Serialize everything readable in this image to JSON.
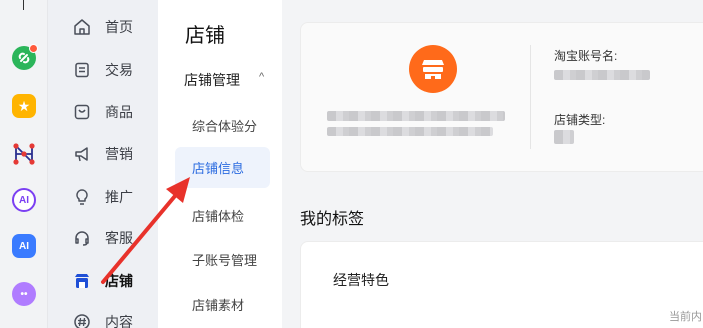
{
  "rail": {
    "apps": [
      {
        "icon": "green-link-app-icon",
        "badge": true
      },
      {
        "icon": "yellow-star-app-icon",
        "glyph": "★"
      },
      {
        "icon": "red-graph-app-icon"
      },
      {
        "icon": "ai-circle-app-icon",
        "glyph": "AI"
      },
      {
        "icon": "ai-square-app-icon",
        "glyph": "AI"
      },
      {
        "icon": "purple-bot-app-icon",
        "glyph": "••"
      }
    ]
  },
  "nav": {
    "items": [
      {
        "label": "首页",
        "icon": "home-icon"
      },
      {
        "label": "交易",
        "icon": "transaction-icon"
      },
      {
        "label": "商品",
        "icon": "product-icon"
      },
      {
        "label": "营销",
        "icon": "megaphone-icon"
      },
      {
        "label": "推广",
        "icon": "lightbulb-icon"
      },
      {
        "label": "客服",
        "icon": "headset-icon"
      },
      {
        "label": "店铺",
        "icon": "store-icon",
        "active": true
      },
      {
        "label": "内容",
        "icon": "hashtag-icon"
      }
    ]
  },
  "subnav": {
    "title": "店铺",
    "group_label": "店铺管理",
    "items": [
      {
        "label": "综合体验分"
      },
      {
        "label": "店铺信息",
        "active": true
      },
      {
        "label": "店铺体检"
      },
      {
        "label": "子账号管理"
      },
      {
        "label": "店铺素材"
      }
    ]
  },
  "shop": {
    "taobao_account_label": "淘宝账号名:",
    "shop_type_label": "店铺类型:"
  },
  "tags": {
    "section_title": "我的标签",
    "subsection": "经营特色",
    "hint": "当前内"
  },
  "colors": {
    "accent": "#2c6ce0",
    "logo": "#ff6a1a",
    "arrow": "#e8322b"
  }
}
